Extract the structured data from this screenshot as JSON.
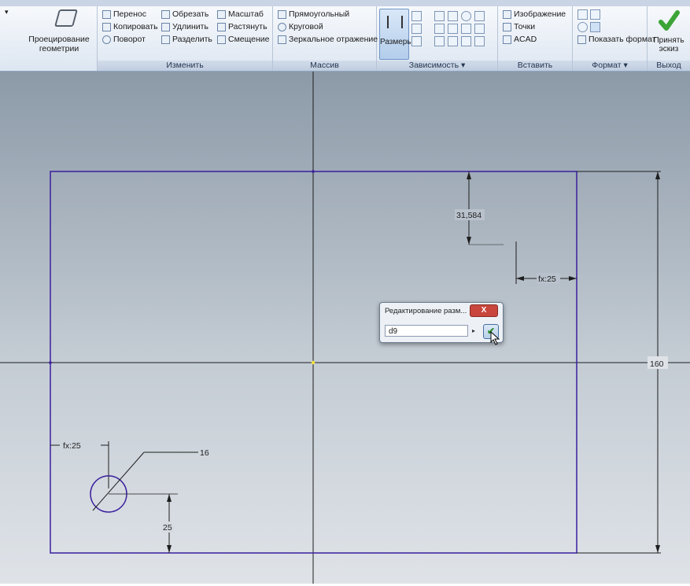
{
  "colors": {
    "sketch_line": "#3a1f9e",
    "axis": "#1e1e1e",
    "accent_green": "#3ca436",
    "ribbon_label": "#25364f"
  },
  "ribbon": {
    "project": {
      "label1": "Проецирование",
      "label2": "геометрии",
      "icon": "project-geometry-icon"
    },
    "modify": {
      "title": "Изменить",
      "col1": [
        "Перенос",
        "Копировать",
        "Поворот"
      ],
      "col2": [
        "Обрезать",
        "Удлинить",
        "Разделить"
      ],
      "col3": [
        "Масштаб",
        "Растянуть",
        "Смещение"
      ]
    },
    "pattern": {
      "title": "Массив",
      "items": [
        "Прямоугольный",
        "Круговой",
        "Зеркальное отражение"
      ]
    },
    "constrain": {
      "title": "Зависимость ▾",
      "dim_label": "Размеры"
    },
    "insert": {
      "title": "Вставить",
      "items": [
        "Изображение",
        "Точки",
        "ACAD"
      ]
    },
    "format": {
      "title": "Формат ▾",
      "show_format": "Показать формат"
    },
    "exit": {
      "title": "Выход",
      "accept1": "Принять",
      "accept2": "эскиз"
    }
  },
  "drawing": {
    "dims": {
      "d_top": "31,584",
      "d_right": "fx:25",
      "d_height": "160",
      "d_left": "fx:25",
      "d_diameter": "16",
      "d_bottom": "25"
    }
  },
  "dialog": {
    "title": "Редактирование разм...",
    "close": "X",
    "value": "d9",
    "ok": "✔"
  }
}
